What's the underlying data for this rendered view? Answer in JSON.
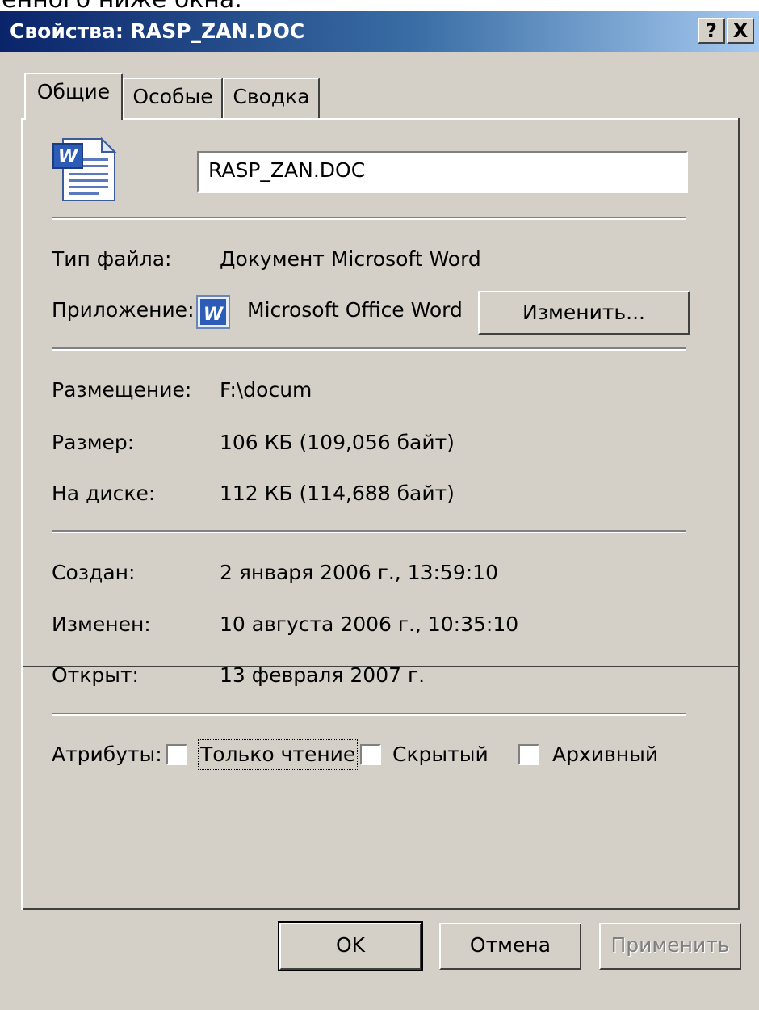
{
  "top_snippet": "енного ниже окна.",
  "window": {
    "title": "Свойства: RASP_ZAN.DOC",
    "help_label": "?",
    "close_label": "X"
  },
  "tabs": [
    {
      "label": "Общие",
      "active": true
    },
    {
      "label": "Особые",
      "active": false
    },
    {
      "label": "Сводка",
      "active": false
    }
  ],
  "file": {
    "name_value": "RASP_ZAN.DOC",
    "icon": "word-document-icon"
  },
  "props": {
    "type_label": "Тип файла:",
    "type_value": "Документ Microsoft Word",
    "app_label": "Приложение:",
    "app_icon": "word-app-icon",
    "app_value": "Microsoft Office Word",
    "change_button": "Изменить...",
    "location_label": "Размещение:",
    "location_value": "F:\\docum",
    "size_label": "Размер:",
    "size_value": "106 КБ (109,056 байт)",
    "disk_label": "На диске:",
    "disk_value": "112 КБ (114,688 байт)",
    "created_label": "Создан:",
    "created_value": "2 января 2006 г., 13:59:10",
    "modified_label": "Изменен:",
    "modified_value": "10 августа 2006 г., 10:35:10",
    "opened_label": "Открыт:",
    "opened_value": "13 февраля 2007 г."
  },
  "attributes": {
    "label": "Атрибуты:",
    "readonly_label": "Только чтение",
    "readonly_checked": false,
    "hidden_label": "Скрытый",
    "hidden_checked": false,
    "archive_label": "Архивный",
    "archive_checked": false
  },
  "buttons": {
    "ok": "OK",
    "cancel": "Отмена",
    "apply": "Применить"
  },
  "colors": {
    "titlebar_start": "#0a246a",
    "titlebar_end": "#a6caf0",
    "dialog_bg": "#d4d0c8"
  }
}
